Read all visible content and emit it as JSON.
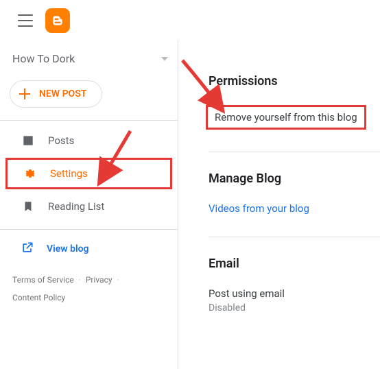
{
  "blog": {
    "name": "How To Dork"
  },
  "buttons": {
    "newPost": "NEW POST"
  },
  "nav": {
    "posts": "Posts",
    "settings": "Settings",
    "readingList": "Reading List",
    "viewBlog": "View blog"
  },
  "footer": {
    "terms": "Terms of Service",
    "privacy": "Privacy",
    "content": "Content Policy"
  },
  "sections": {
    "permissions": {
      "title": "Permissions",
      "removeSelf": "Remove yourself from this blog"
    },
    "manage": {
      "title": "Manage Blog",
      "videos": "Videos from your blog"
    },
    "email": {
      "title": "Email",
      "postUsing": "Post using email",
      "postUsingStatus": "Disabled"
    }
  }
}
